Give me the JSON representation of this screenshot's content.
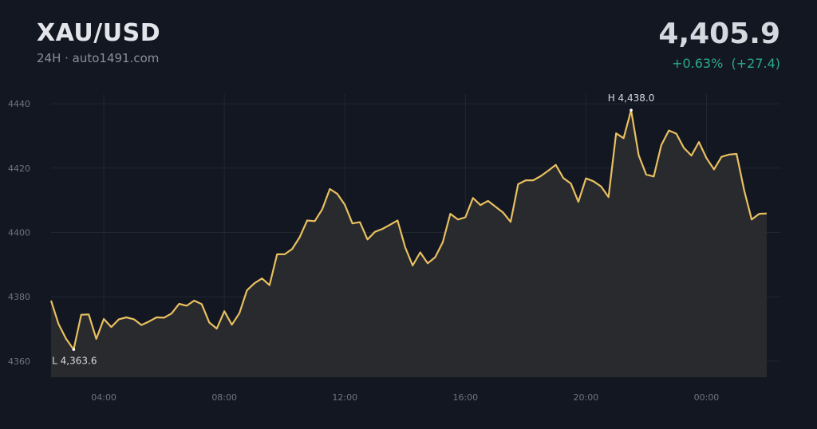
{
  "header": {
    "symbol": "XAU/USD",
    "subtitle": "24H · auto1491.com",
    "price": "4,405.9",
    "change": "+0.63%  (+27.4)"
  },
  "colors": {
    "line": "#e8c060",
    "up": "#2aa98b",
    "background": "#131722"
  },
  "chart_data": {
    "type": "line",
    "x_ticks": [
      "04:00",
      "08:00",
      "12:00",
      "16:00",
      "20:00",
      "00:00"
    ],
    "y_ticks": [
      4360,
      4380,
      4400,
      4420,
      4440
    ],
    "ylim": [
      4355,
      4443
    ],
    "grid": true,
    "high": {
      "label": "H 4,438.0",
      "value": 4438.0
    },
    "low": {
      "label": "L 4,363.6",
      "value": 4363.6
    },
    "series": [
      {
        "values": [
          4378.8,
          4371.5,
          4366.9,
          4363.6,
          4374.4,
          4374.5,
          4366.9,
          4373.1,
          4370.6,
          4373.0,
          4373.6,
          4373.0,
          4371.2,
          4372.3,
          4373.6,
          4373.5,
          4374.8,
          4377.8,
          4377.2,
          4378.8,
          4377.7,
          4372.0,
          4370.1,
          4375.5,
          4371.3,
          4374.9,
          4382.0,
          4384.2,
          4385.7,
          4383.6,
          4393.2,
          4393.2,
          4394.8,
          4398.5,
          4403.7,
          4403.5,
          4407.2,
          4413.5,
          4412.0,
          4408.6,
          4402.8,
          4403.2,
          4397.8,
          4400.2,
          4401.1,
          4402.4,
          4403.7,
          4395.4,
          4389.7,
          4393.8,
          4390.4,
          4392.3,
          4397.0,
          4405.8,
          4404.0,
          4404.7,
          4410.7,
          4408.5,
          4409.8,
          4408.0,
          4406.2,
          4403.3,
          4415.0,
          4416.2,
          4416.2,
          4417.5,
          4419.2,
          4421.0,
          4416.9,
          4415.2,
          4409.5,
          4416.8,
          4415.9,
          4414.3,
          4411.0,
          4430.8,
          4429.3,
          4438.0,
          4424.0,
          4418.0,
          4417.4,
          4427.1,
          4431.7,
          4430.7,
          4426.3,
          4423.9,
          4428.1,
          4423.1,
          4419.6,
          4423.5,
          4424.2,
          4424.4,
          4413.1,
          4404.0,
          4405.8,
          4405.9
        ]
      }
    ]
  }
}
